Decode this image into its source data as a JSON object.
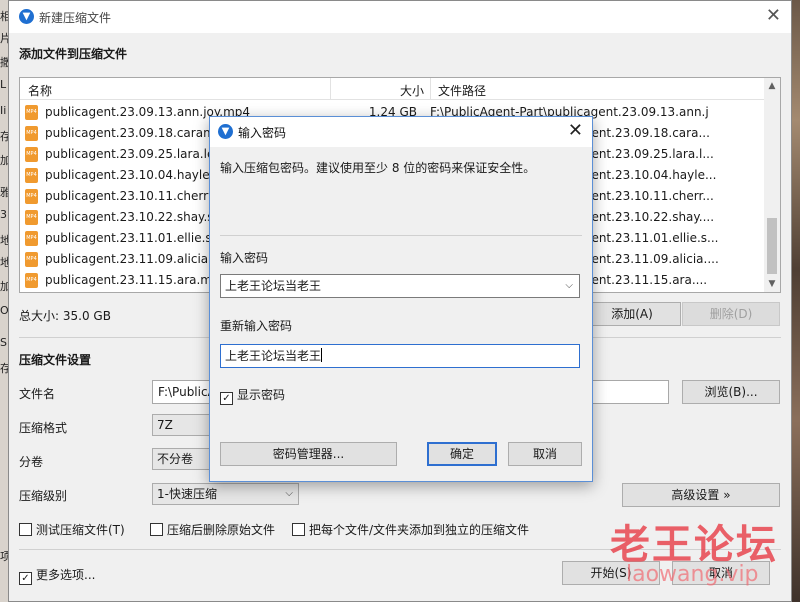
{
  "main": {
    "title": "新建压缩文件",
    "add_section_title": "添加文件到压缩文件",
    "columns": {
      "name": "名称",
      "size": "大小",
      "path": "文件路径"
    },
    "files": [
      {
        "name": "publicagent.23.09.13.ann.joy.mp4",
        "size": "1.24 GB",
        "path": "F:\\PublicAgent-Part\\publicagent.23.09.13.ann.j..."
      },
      {
        "name": "publicagent.23.09.18.carame",
        "size": "",
        "path": "...ent.23.09.18.cara..."
      },
      {
        "name": "publicagent.23.09.25.lara.lee.",
        "size": "",
        "path": "...ent.23.09.25.lara.l..."
      },
      {
        "name": "publicagent.23.10.04.hayley.v",
        "size": "",
        "path": "...ent.23.10.04.hayle..."
      },
      {
        "name": "publicagent.23.10.11.cherry.c",
        "size": "",
        "path": "...ent.23.10.11.cherr..."
      },
      {
        "name": "publicagent.23.10.22.shay.sig",
        "size": "",
        "path": "...ent.23.10.22.shay...."
      },
      {
        "name": "publicagent.23.11.01.ellie.sho",
        "size": "",
        "path": "...ent.23.11.01.ellie.s..."
      },
      {
        "name": "publicagent.23.11.09.alicia.tre",
        "size": "",
        "path": "...ent.23.11.09.alicia...."
      },
      {
        "name": "publicagent.23.11.15.ara.mix.",
        "size": "",
        "path": "...ent.23.11.15.ara...."
      }
    ],
    "total_size": "总大小: 35.0 GB",
    "add_button": "添加(A)",
    "delete_button": "删除(D)",
    "settings_title": "压缩文件设置",
    "filename_label": "文件名",
    "filename_value": "F:\\PublicA",
    "browse_button": "浏览(B)...",
    "format_label": "压缩格式",
    "format_value": "7Z",
    "volume_label": "分卷",
    "volume_value": "不分卷",
    "level_label": "压缩级别",
    "level_value": "1-快速压缩",
    "advanced_button": "高级设置 »",
    "test_checkbox": "测试压缩文件(T)",
    "delete_original_checkbox": "压缩后删除原始文件",
    "separate_checkbox": "把每个文件/文件夹添加到独立的压缩文件",
    "more_options_checkbox": "更多选项...",
    "start_button": "开始(S)",
    "cancel_button": "取消"
  },
  "dialog": {
    "title": "输入密码",
    "hint": "输入压缩包密码。建议使用至少 8 位的密码来保证安全性。",
    "password_label": "输入密码",
    "password_value": "上老王论坛当老王",
    "reenter_label": "重新输入密码",
    "reenter_value": "上老王论坛当老王",
    "show_password": "显示密码",
    "manager_button": "密码管理器...",
    "ok_button": "确定",
    "cancel_button": "取消"
  },
  "background": {
    "left_chars": [
      "相",
      "片",
      "撒",
      "L",
      "Ii",
      "存",
      "加",
      "雅",
      "3",
      "地",
      "地",
      "加",
      "OS",
      "SH",
      "存",
      "项"
    ]
  },
  "watermark": {
    "text": "老王论坛",
    "url": "laowang.vip"
  },
  "icons": [
    "app-icon",
    "close-icon",
    "mp4-file-icon",
    "dropdown-arrow-icon",
    "scroll-up-icon",
    "scroll-down-icon",
    "checkbox-checked-icon"
  ]
}
